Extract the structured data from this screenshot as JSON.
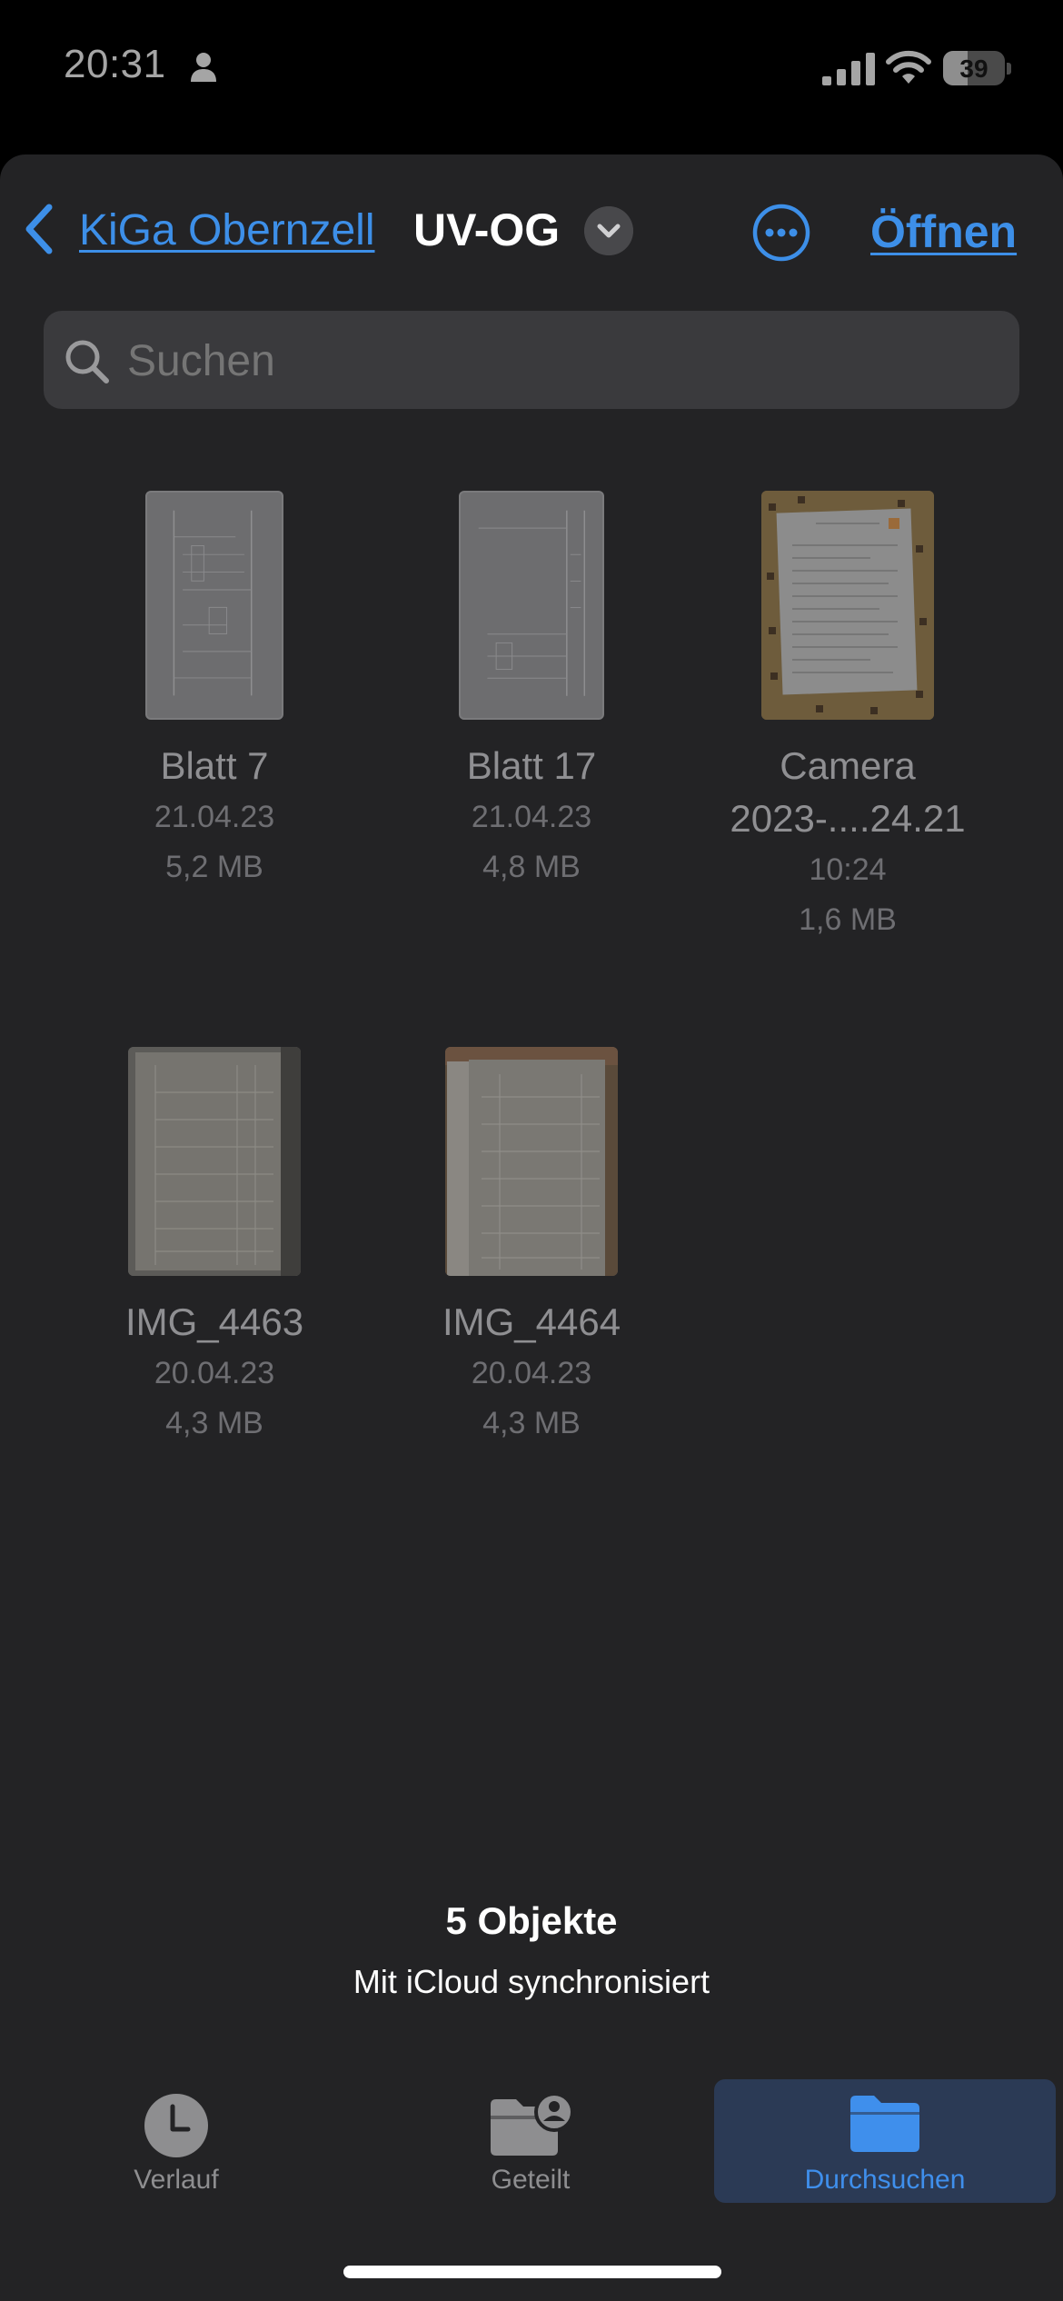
{
  "status_bar": {
    "time": "20:31",
    "battery": "39",
    "battery_level": 0.39
  },
  "nav": {
    "back_label": "KiGa Obernzell",
    "title": "UV-OG",
    "open_label": "Öffnen"
  },
  "search": {
    "placeholder": "Suchen"
  },
  "files": [
    {
      "name": "Blatt 7",
      "date": "21.04.23",
      "size": "5,2 MB",
      "kind": "document"
    },
    {
      "name": "Blatt 17",
      "date": "21.04.23",
      "size": "4,8 MB",
      "kind": "document"
    },
    {
      "name_line1": "Camera",
      "name_line2": "2023-....24.21",
      "date": "10:24",
      "size": "1,6 MB",
      "kind": "photo"
    },
    {
      "name": "IMG_4463",
      "date": "20.04.23",
      "size": "4,3 MB",
      "kind": "photo"
    },
    {
      "name": "IMG_4464",
      "date": "20.04.23",
      "size": "4,3 MB",
      "kind": "photo"
    }
  ],
  "footer": {
    "count": "5 Objekte",
    "sync": "Mit iCloud synchronisiert"
  },
  "tabs": [
    {
      "label": "Verlauf",
      "icon": "clock-icon",
      "active": false
    },
    {
      "label": "Geteilt",
      "icon": "shared-folder-icon",
      "active": false
    },
    {
      "label": "Durchsuchen",
      "icon": "folder-icon",
      "active": true
    }
  ],
  "colors": {
    "accent": "#3d8fe8",
    "background": "#232325",
    "search_bg": "#3a3a3d"
  }
}
